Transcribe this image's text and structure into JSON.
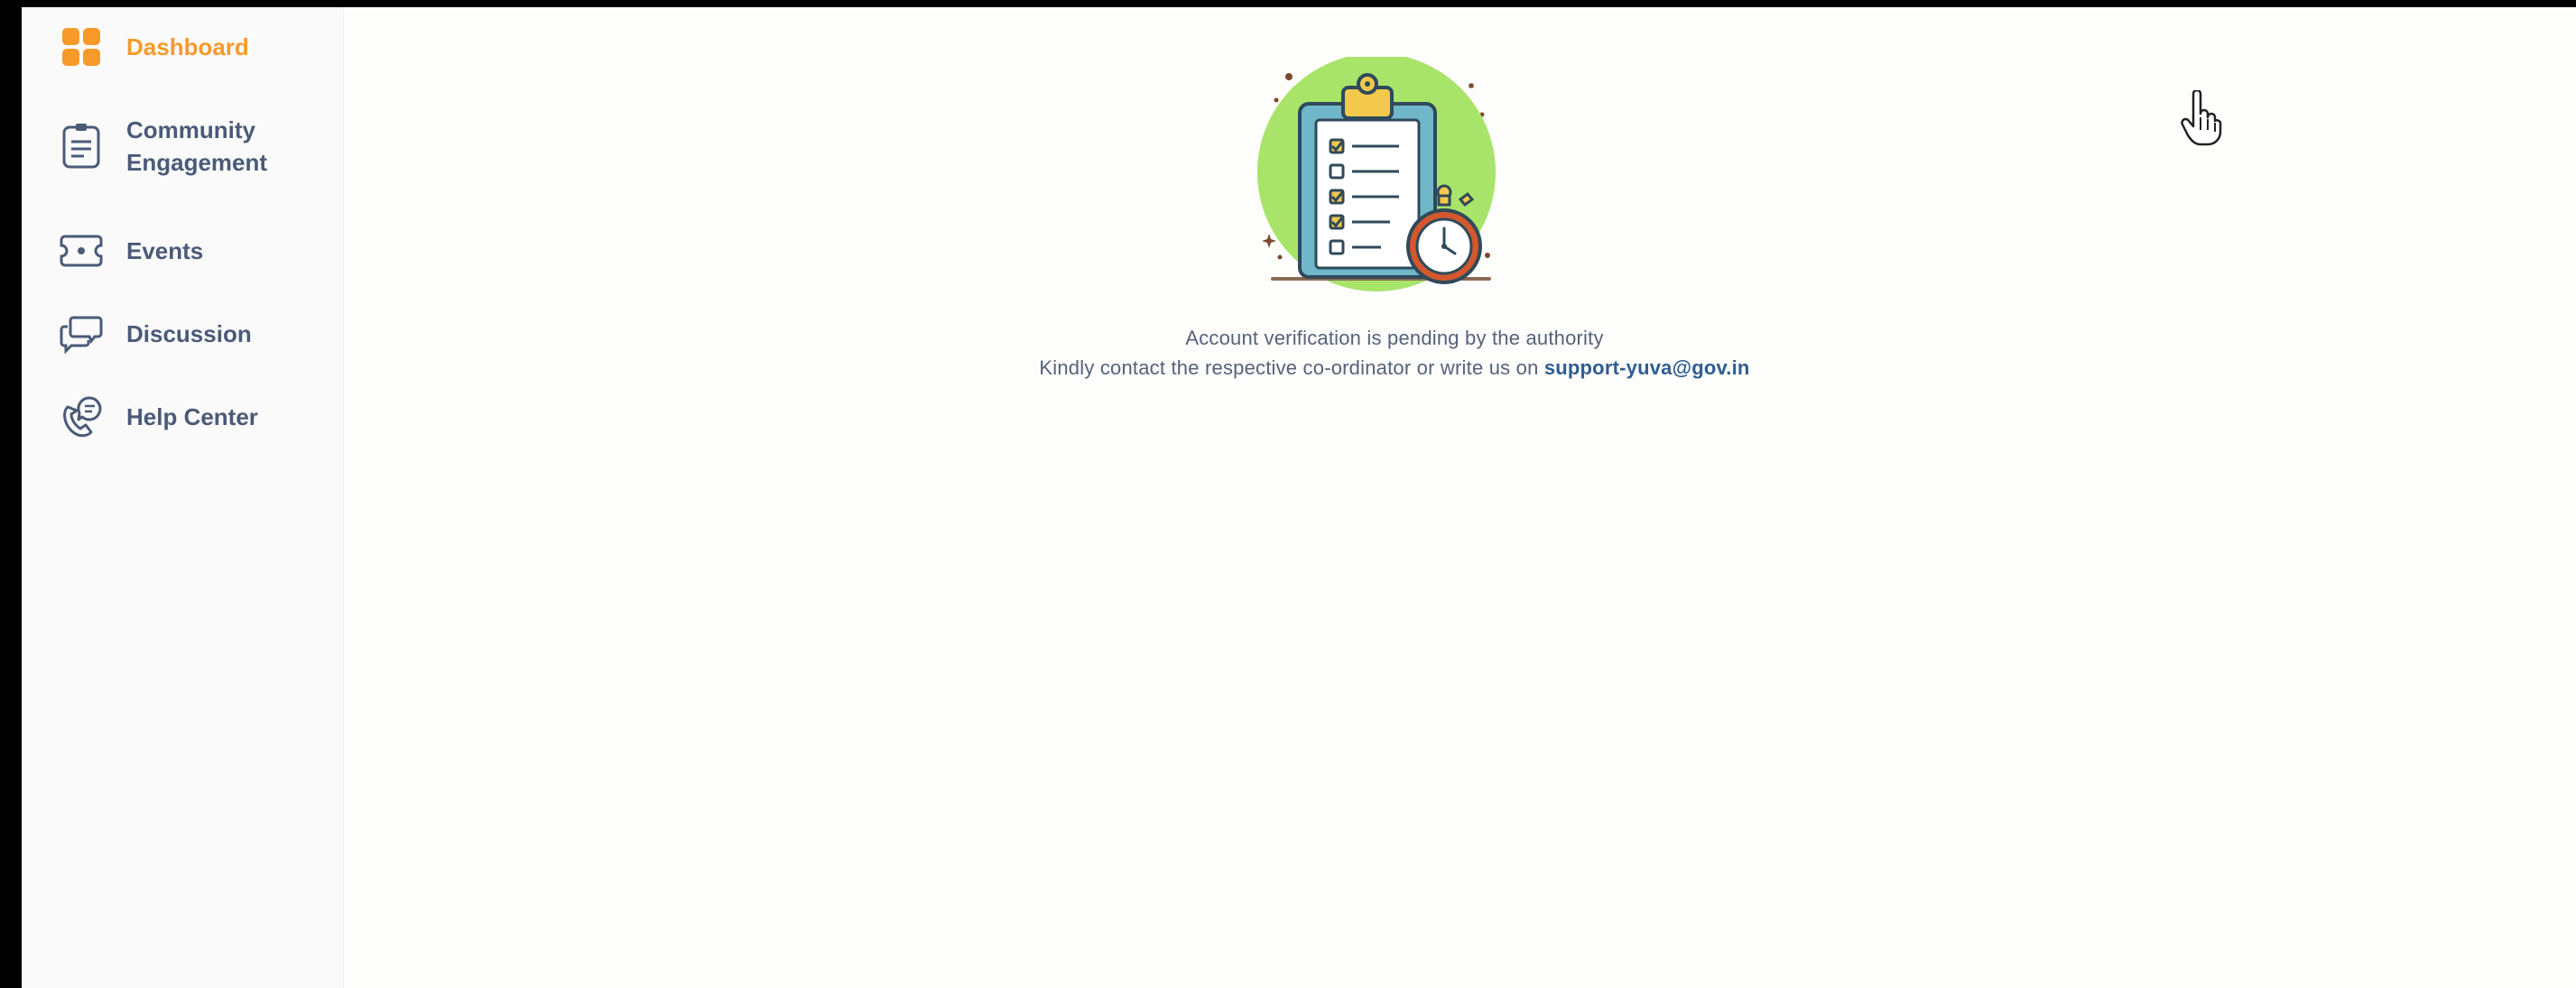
{
  "sidebar": {
    "items": [
      {
        "label": "Dashboard",
        "icon": "dashboard-grid-icon",
        "active": true
      },
      {
        "label": "Community Engagement",
        "icon": "clipboard-icon",
        "active": false
      },
      {
        "label": "Events",
        "icon": "ticket-icon",
        "active": false
      },
      {
        "label": "Discussion",
        "icon": "chat-bubbles-icon",
        "active": false
      },
      {
        "label": "Help Center",
        "icon": "phone-support-icon",
        "active": false
      }
    ]
  },
  "main": {
    "message_line1": "Account verification is pending by the authority",
    "message_line2_prefix": "Kindly contact the respective co-ordinator or write us on ",
    "support_email": "support-yuva@gov.in",
    "illustration": "clipboard-checklist-stopwatch-illustration"
  },
  "colors": {
    "accent": "#f79a2a",
    "nav_text": "#4a5a78",
    "link": "#2e5e8e",
    "illustration_circle": "#a9e46a"
  }
}
